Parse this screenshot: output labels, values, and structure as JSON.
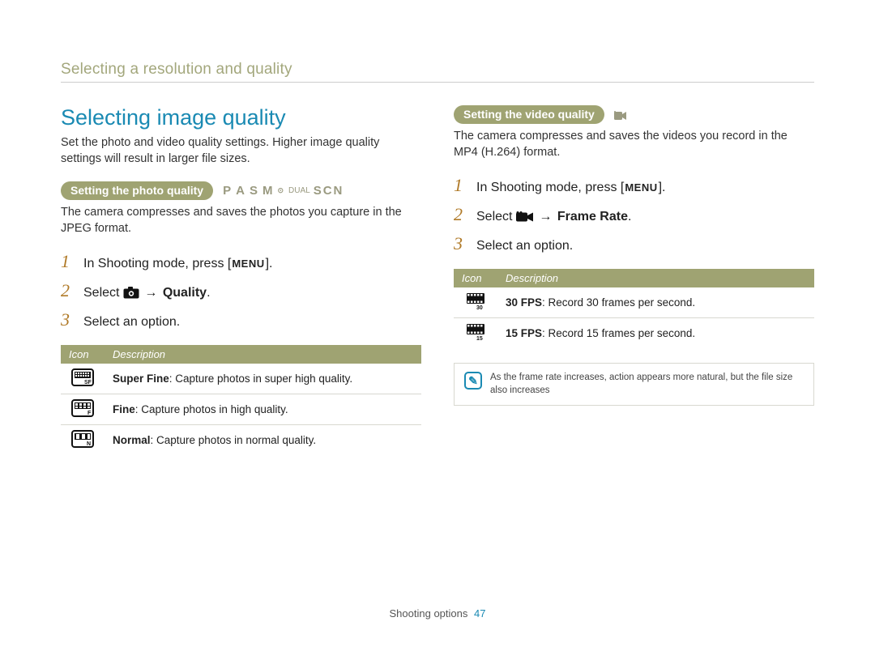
{
  "breadcrumb": "Selecting a resolution and quality",
  "heading": "Selecting image quality",
  "intro": "Set the photo and video quality settings. Higher image quality settings will result in larger file sizes.",
  "photo": {
    "pill": "Setting the photo quality",
    "modes": [
      "P",
      "A",
      "S",
      "M"
    ],
    "mode_dual": "DUAL",
    "mode_scn": "SCN",
    "body": "The camera compresses and saves the photos you capture in the JPEG format.",
    "steps": {
      "s1_a": "In Shooting mode, press [",
      "s1_menu": "MENU",
      "s1_b": "].",
      "s2_a": "Select ",
      "s2_arrow": " → ",
      "s2_bold": "Quality",
      "s2_b": ".",
      "s3": "Select an option."
    },
    "table": {
      "h_icon": "Icon",
      "h_desc": "Description",
      "rows": [
        {
          "label": "Super Fine",
          "text": ": Capture photos in super high quality.",
          "badge": "SF"
        },
        {
          "label": "Fine",
          "text": ": Capture photos in high quality.",
          "badge": "F"
        },
        {
          "label": "Normal",
          "text": ": Capture photos in normal quality.",
          "badge": "N"
        }
      ]
    }
  },
  "video": {
    "pill": "Setting the video quality",
    "body": "The camera compresses and saves the videos you record in the MP4 (H.264) format.",
    "steps": {
      "s1_a": "In Shooting mode, press [",
      "s1_menu": "MENU",
      "s1_b": "].",
      "s2_a": "Select ",
      "s2_arrow": " → ",
      "s2_bold": "Frame Rate",
      "s2_b": ".",
      "s3": "Select an option."
    },
    "table": {
      "h_icon": "Icon",
      "h_desc": "Description",
      "rows": [
        {
          "label": "30 FPS",
          "text": ": Record 30 frames per second.",
          "badge": "30"
        },
        {
          "label": "15 FPS",
          "text": ": Record 15 frames per second.",
          "badge": "15"
        }
      ]
    },
    "note": "As the frame rate increases, action appears more natural, but the file size also increases"
  },
  "footer": {
    "section": "Shooting options",
    "page": "47"
  }
}
